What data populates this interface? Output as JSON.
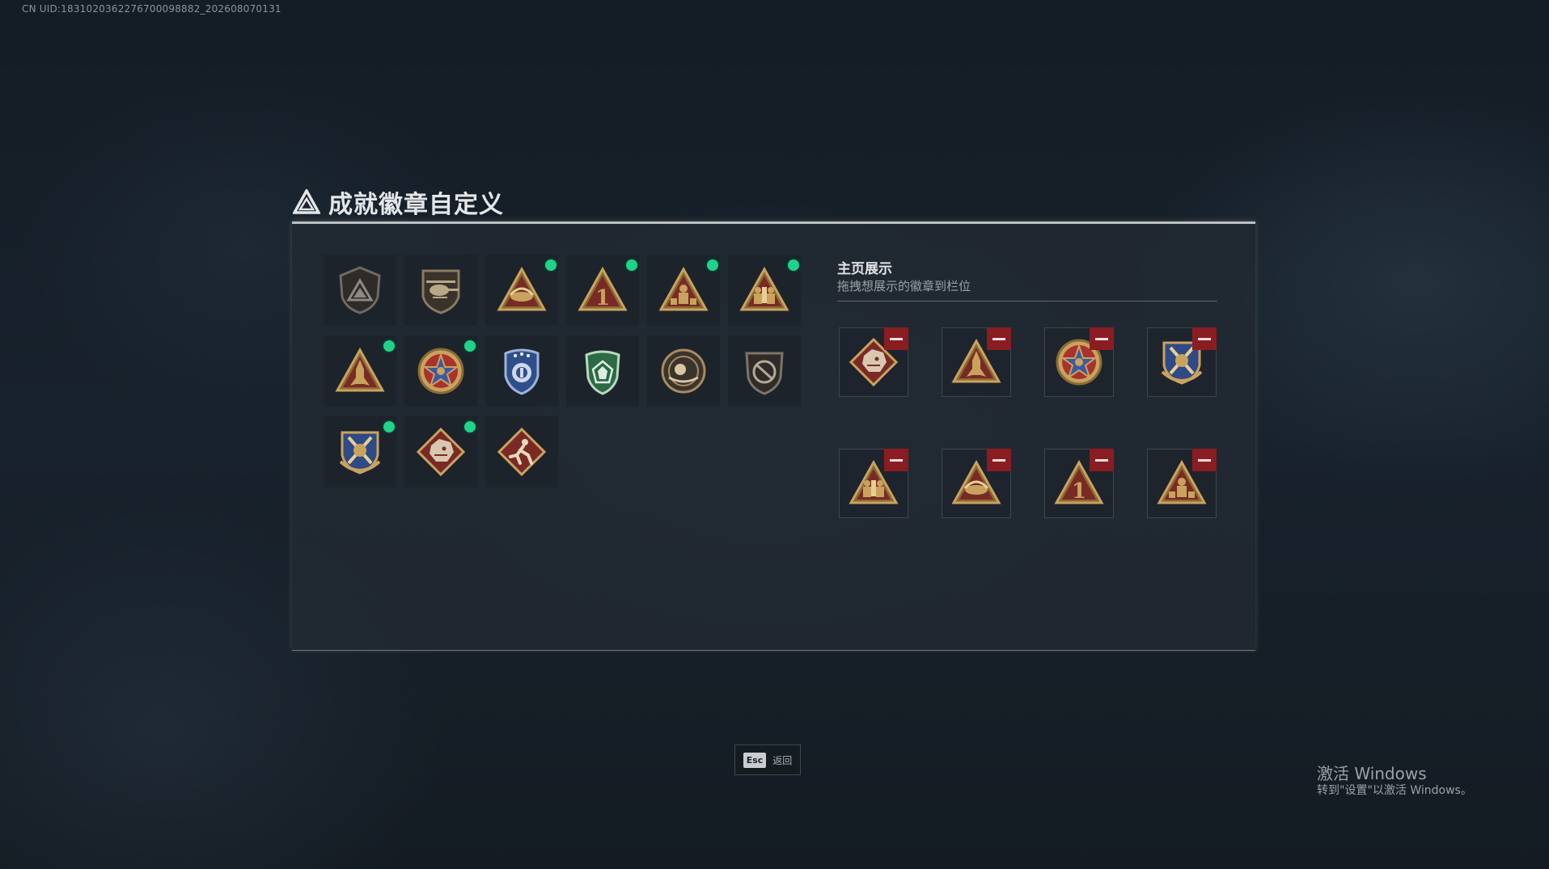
{
  "uid": "CN UID:1831020362276700098882_202608070131",
  "title": "成就徽章自定义",
  "colors": {
    "gold": "#c9a25e",
    "red": "#8a1d22",
    "green_dot": "#21d28a",
    "accent": "#e3e6e8"
  },
  "badges": [
    {
      "icon": "shield-triangle-badge-icon",
      "new": false
    },
    {
      "icon": "helicopter-badge-icon",
      "new": false
    },
    {
      "icon": "eagle-triangle-badge-icon",
      "new": true
    },
    {
      "icon": "number-one-triangle-badge-icon",
      "new": true
    },
    {
      "icon": "soldier-triangle-badge-icon",
      "new": true
    },
    {
      "icon": "soldiers-triangle-badge-icon",
      "new": true
    },
    {
      "icon": "rocket-triangle-badge-icon",
      "new": true
    },
    {
      "icon": "star-medal-badge-icon",
      "new": true
    },
    {
      "icon": "blue-police-badge-icon",
      "new": false
    },
    {
      "icon": "green-shield-badge-icon",
      "new": false
    },
    {
      "icon": "round-medal-badge-icon",
      "new": false
    },
    {
      "icon": "no-sign-shield-badge-icon",
      "new": false
    },
    {
      "icon": "crossed-swords-shield-badge-icon",
      "new": true
    },
    {
      "icon": "dragon-diamond-badge-icon",
      "new": true
    },
    {
      "icon": "runner-diamond-badge-icon",
      "new": false
    }
  ],
  "home": {
    "title": "主页展示",
    "subtitle": "拖拽想展示的徽章到栏位",
    "slots": [
      {
        "icon": "dragon-diamond-badge-icon"
      },
      {
        "icon": "rocket-triangle-badge-icon"
      },
      {
        "icon": "star-medal-badge-icon"
      },
      {
        "icon": "crossed-swords-shield-badge-icon"
      },
      {
        "icon": "soldiers-triangle-badge-icon"
      },
      {
        "icon": "eagle-triangle-badge-icon"
      },
      {
        "icon": "number-one-triangle-badge-icon"
      },
      {
        "icon": "soldier-triangle-badge-icon"
      }
    ]
  },
  "esc": {
    "key": "Esc",
    "label": "返回"
  },
  "windows": {
    "title": "激活 Windows",
    "subtitle": "转到\"设置\"以激活 Windows。"
  }
}
